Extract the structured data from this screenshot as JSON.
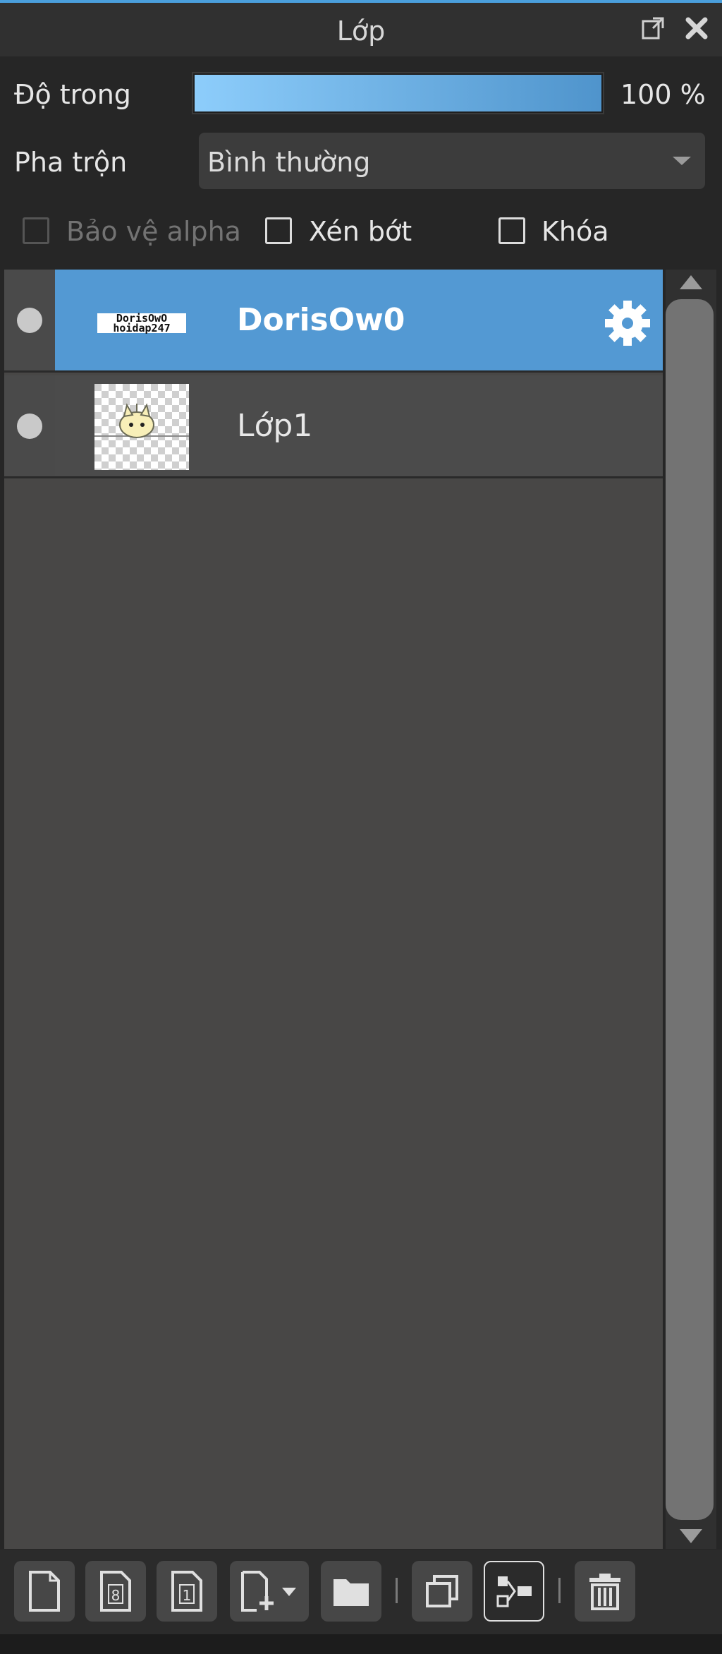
{
  "window": {
    "title": "Lớp"
  },
  "opacity": {
    "label": "Độ trong",
    "value_text": "100 %",
    "level": 1.0
  },
  "blend": {
    "label": "Pha trộn",
    "selected": "Bình thường"
  },
  "checkboxes": {
    "protect_alpha": {
      "label": "Bảo vệ alpha",
      "checked": false,
      "enabled": false
    },
    "clipping": {
      "label": "Xén bớt",
      "checked": false,
      "enabled": true
    },
    "lock": {
      "label": "Khóa",
      "checked": false,
      "enabled": true
    }
  },
  "layers": [
    {
      "name": "DorisOw0",
      "thumb_text_1": "DorisOwO",
      "thumb_text_2": "hoidap247",
      "selected": true,
      "icon": "gear-icon"
    },
    {
      "name": "Lớp1",
      "selected": false
    }
  ],
  "toolbar_icons": [
    "new-layer-icon",
    "new-layer-8bit-icon",
    "new-layer-1bit-icon",
    "add-layer-dropdown-icon",
    "folder-icon",
    "duplicate-icon",
    "merge-icon",
    "delete-icon"
  ],
  "colors": {
    "accent": "#5399d3",
    "title_line": "#4a9fdc"
  }
}
